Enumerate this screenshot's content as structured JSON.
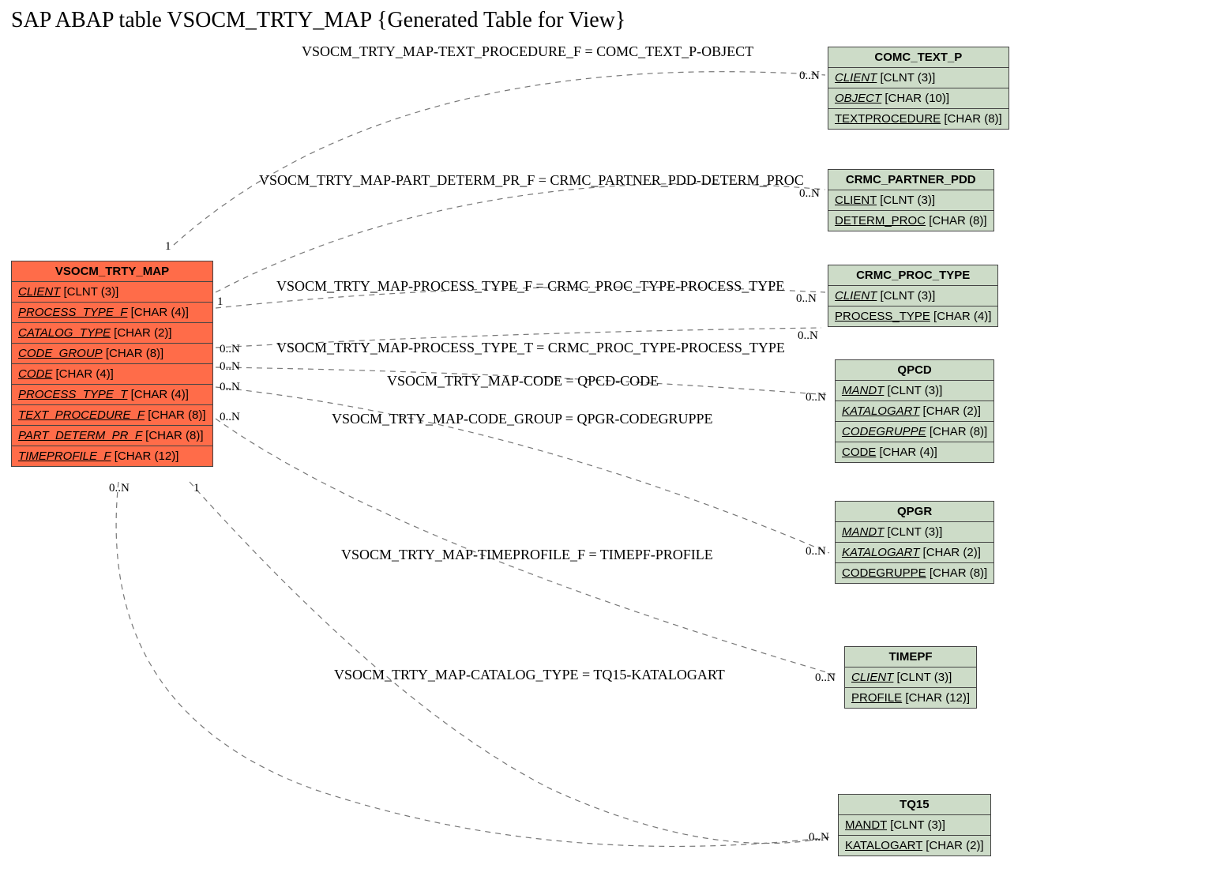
{
  "title": "SAP ABAP table VSOCM_TRTY_MAP {Generated Table for View}",
  "main_entity": {
    "name": "VSOCM_TRTY_MAP",
    "fields": [
      {
        "name": "CLIENT",
        "type": "[CLNT (3)]",
        "italic": true
      },
      {
        "name": "PROCESS_TYPE_F",
        "type": "[CHAR (4)]",
        "italic": true
      },
      {
        "name": "CATALOG_TYPE",
        "type": "[CHAR (2)]",
        "italic": true
      },
      {
        "name": "CODE_GROUP",
        "type": "[CHAR (8)]",
        "italic": true
      },
      {
        "name": "CODE",
        "type": "[CHAR (4)]",
        "italic": true
      },
      {
        "name": "PROCESS_TYPE_T",
        "type": "[CHAR (4)]",
        "italic": true
      },
      {
        "name": "TEXT_PROCEDURE_F",
        "type": "[CHAR (8)]",
        "italic": true
      },
      {
        "name": "PART_DETERM_PR_F",
        "type": "[CHAR (8)]",
        "italic": true
      },
      {
        "name": "TIMEPROFILE_F",
        "type": "[CHAR (12)]",
        "italic": true
      }
    ]
  },
  "related": [
    {
      "name": "COMC_TEXT_P",
      "fields": [
        {
          "name": "CLIENT",
          "type": "[CLNT (3)]",
          "italic": true
        },
        {
          "name": "OBJECT",
          "type": "[CHAR (10)]",
          "italic": true
        },
        {
          "name": "TEXTPROCEDURE",
          "type": "[CHAR (8)]",
          "italic": false
        }
      ]
    },
    {
      "name": "CRMC_PARTNER_PDD",
      "fields": [
        {
          "name": "CLIENT",
          "type": "[CLNT (3)]",
          "italic": false
        },
        {
          "name": "DETERM_PROC",
          "type": "[CHAR (8)]",
          "italic": false
        }
      ]
    },
    {
      "name": "CRMC_PROC_TYPE",
      "fields": [
        {
          "name": "CLIENT",
          "type": "[CLNT (3)]",
          "italic": true
        },
        {
          "name": "PROCESS_TYPE",
          "type": "[CHAR (4)]",
          "italic": false
        }
      ]
    },
    {
      "name": "QPCD",
      "fields": [
        {
          "name": "MANDT",
          "type": "[CLNT (3)]",
          "italic": true
        },
        {
          "name": "KATALOGART",
          "type": "[CHAR (2)]",
          "italic": true
        },
        {
          "name": "CODEGRUPPE",
          "type": "[CHAR (8)]",
          "italic": true
        },
        {
          "name": "CODE",
          "type": "[CHAR (4)]",
          "italic": false
        }
      ]
    },
    {
      "name": "QPGR",
      "fields": [
        {
          "name": "MANDT",
          "type": "[CLNT (3)]",
          "italic": true
        },
        {
          "name": "KATALOGART",
          "type": "[CHAR (2)]",
          "italic": true
        },
        {
          "name": "CODEGRUPPE",
          "type": "[CHAR (8)]",
          "italic": false
        }
      ]
    },
    {
      "name": "TIMEPF",
      "fields": [
        {
          "name": "CLIENT",
          "type": "[CLNT (3)]",
          "italic": true
        },
        {
          "name": "PROFILE",
          "type": "[CHAR (12)]",
          "italic": false
        }
      ]
    },
    {
      "name": "TQ15",
      "fields": [
        {
          "name": "MANDT",
          "type": "[CLNT (3)]",
          "italic": false
        },
        {
          "name": "KATALOGART",
          "type": "[CHAR (2)]",
          "italic": false
        }
      ]
    }
  ],
  "relations": [
    {
      "label": "VSOCM_TRTY_MAP-TEXT_PROCEDURE_F = COMC_TEXT_P-OBJECT",
      "left_card": "1",
      "right_card": "0..N"
    },
    {
      "label": "VSOCM_TRTY_MAP-PART_DETERM_PR_F = CRMC_PARTNER_PDD-DETERM_PROC",
      "left_card": "1",
      "right_card": "0..N"
    },
    {
      "label": "VSOCM_TRTY_MAP-PROCESS_TYPE_F = CRMC_PROC_TYPE-PROCESS_TYPE",
      "left_card": "",
      "right_card": "0..N"
    },
    {
      "label": "VSOCM_TRTY_MAP-PROCESS_TYPE_T = CRMC_PROC_TYPE-PROCESS_TYPE",
      "left_card": "0..N",
      "right_card": "0..N"
    },
    {
      "label": "VSOCM_TRTY_MAP-CODE = QPCD-CODE",
      "left_card": "0..N",
      "right_card": "0..N"
    },
    {
      "label": "VSOCM_TRTY_MAP-CODE_GROUP = QPGR-CODEGRUPPE",
      "left_card": "0..N",
      "right_card": ""
    },
    {
      "label": "VSOCM_TRTY_MAP-TIMEPROFILE_F = TIMEPF-PROFILE",
      "left_card": "0..N",
      "right_card": "0..N"
    },
    {
      "label": "VSOCM_TRTY_MAP-CATALOG_TYPE = TQ15-KATALOGART",
      "left_card": "1",
      "right_card": "0..N"
    }
  ],
  "extra_cards": {
    "bottom_left": "0..N"
  }
}
